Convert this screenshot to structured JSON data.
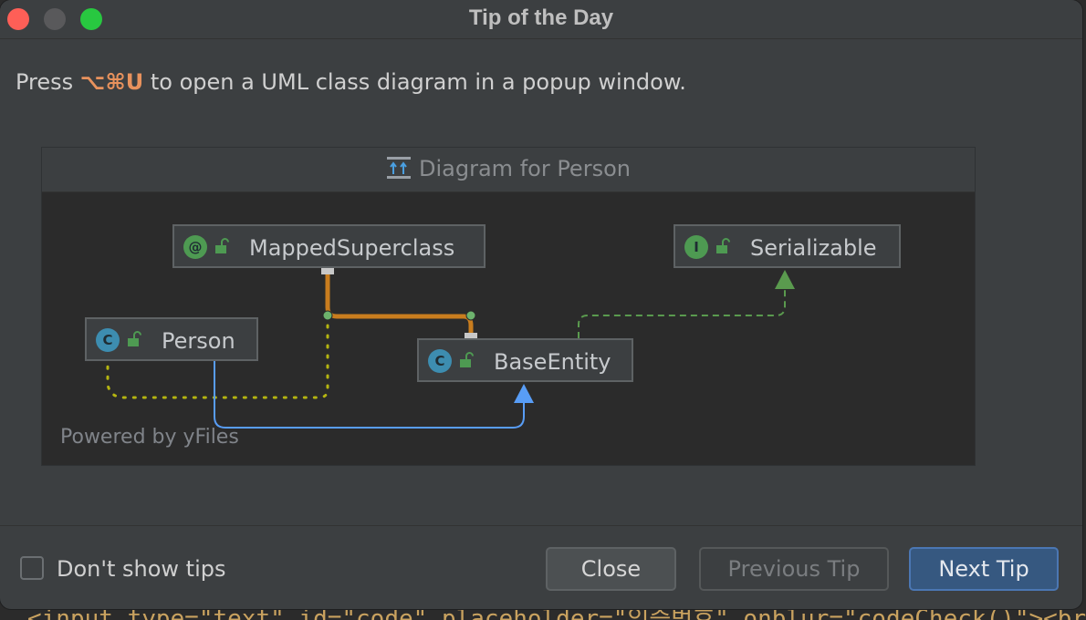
{
  "window": {
    "title": "Tip of the Day"
  },
  "tip": {
    "prefix": "Press ",
    "shortcut": "⌥⌘U",
    "suffix": " to open a UML class diagram in a popup window."
  },
  "preview": {
    "title": "Diagram for Person",
    "nodes": {
      "mapped_superclass": {
        "badge": "@",
        "label": "MappedSuperclass"
      },
      "serializable": {
        "badge": "I",
        "label": "Serializable"
      },
      "person": {
        "badge": "C",
        "label": "Person"
      },
      "base_entity": {
        "badge": "C",
        "label": "BaseEntity"
      }
    },
    "powered_by": "Powered by yFiles"
  },
  "footer": {
    "dont_show_label": "Don't show tips",
    "dont_show_checked": false,
    "close_label": "Close",
    "previous_label": "Previous Tip",
    "next_label": "Next Tip"
  },
  "background_code": "<input type=\"text\" id=\"code\" placeholder=\"인증번호\" onblur=\"codeCheck()\"><br>",
  "colors": {
    "annotation_badge": "#4e9a52",
    "interface_badge": "#4e9a52",
    "class_badge": "#3d8db0",
    "shortcut": "#e8925d",
    "primary_button": "#365880",
    "inheritance_edge": "#589df6",
    "annotation_edge": "#c97d1e",
    "realization_edge": "#5a9a4e",
    "dotted_edge": "#b5b511"
  },
  "icons": {
    "close": "red-traffic-light",
    "minimize": "gray-traffic-light",
    "maximize": "green-traffic-light",
    "diagram": "diagram-icon",
    "lock": "unlock-icon"
  }
}
